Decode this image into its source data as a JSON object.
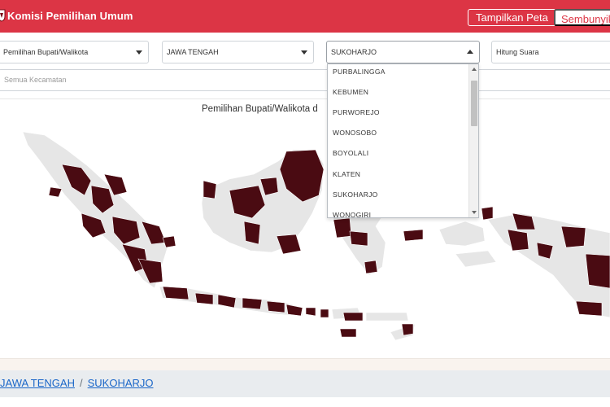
{
  "navbar": {
    "brand": "Komisi Pemilihan Umum",
    "show_map_button": "Tampilkan Peta",
    "hide_button": "Sembunyikan",
    "bg_color": "#dc3545"
  },
  "filters": {
    "election_type": "Pemilihan Bupati/Walikota",
    "province": "JAWA TENGAH",
    "regency": "SUKOHARJO",
    "count_type": "Hitung Suara",
    "district_placeholder": "Semua Kecamatan"
  },
  "regency_dropdown": {
    "options": [
      "PURBALINGGA",
      "KEBUMEN",
      "PURWOREJO",
      "WONOSOBO",
      "BOYOLALI",
      "KLATEN",
      "SUKOHARJO",
      "WONOGIRI"
    ]
  },
  "map": {
    "title": "Pemilihan Bupati/Walikota d",
    "highlight_color": "#4a0b12",
    "base_color": "#e6e6e6"
  },
  "breadcrumb": {
    "province": "JAWA TENGAH",
    "separator": "/",
    "regency": "SUKOHARJO"
  }
}
